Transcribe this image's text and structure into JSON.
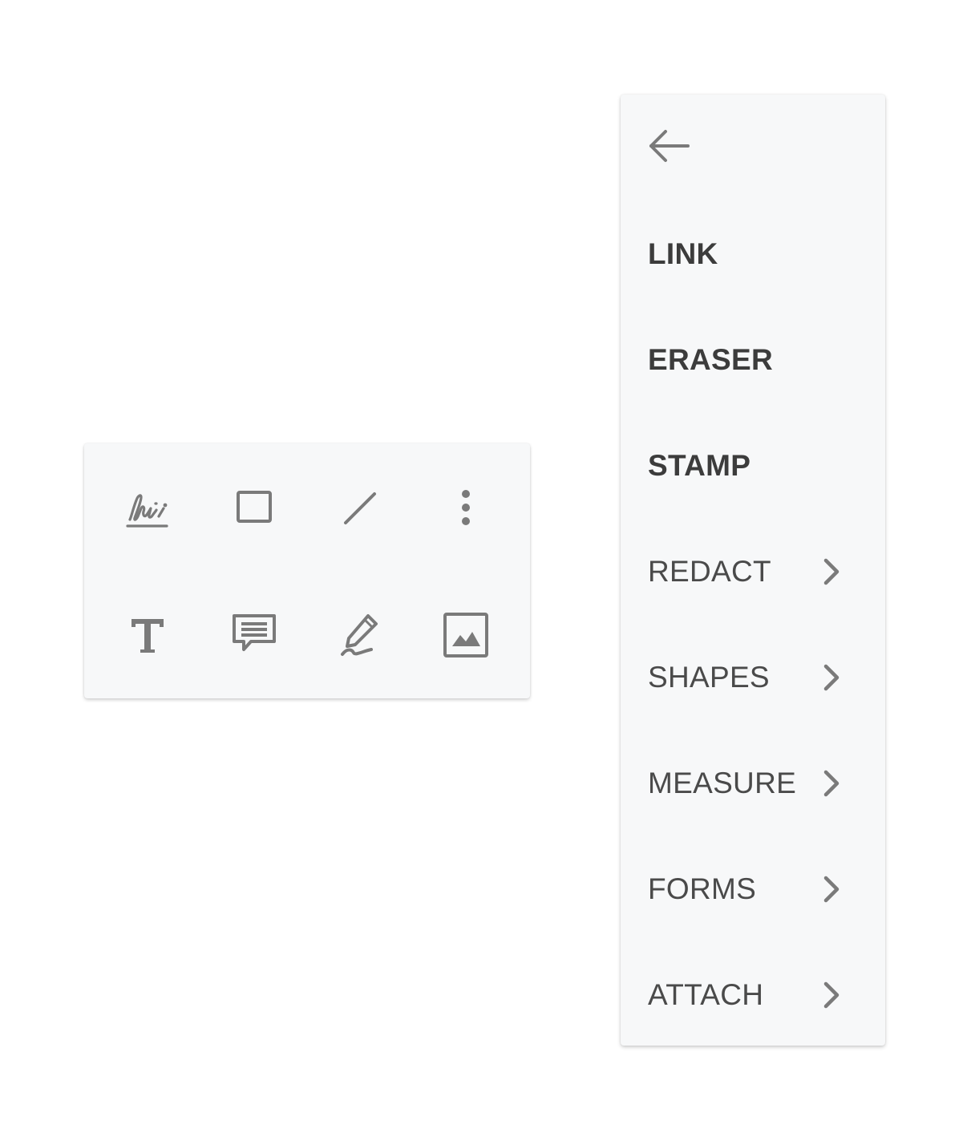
{
  "colors": {
    "panel_bg": "#f7f8f9",
    "icon_color": "#7a7a7a",
    "text_color": "#4a4a4a"
  },
  "toolbar": {
    "tools": [
      {
        "icon": "signature-icon"
      },
      {
        "icon": "rectangle-icon"
      },
      {
        "icon": "line-icon"
      },
      {
        "icon": "more-vertical-icon"
      },
      {
        "icon": "text-icon"
      },
      {
        "icon": "comment-icon"
      },
      {
        "icon": "pen-icon"
      },
      {
        "icon": "image-icon"
      }
    ]
  },
  "menu": {
    "back_icon": "arrow-left-icon",
    "items": [
      {
        "label": "LINK",
        "has_submenu": false
      },
      {
        "label": "ERASER",
        "has_submenu": false
      },
      {
        "label": "STAMP",
        "has_submenu": false
      },
      {
        "label": "REDACT",
        "has_submenu": true
      },
      {
        "label": "SHAPES",
        "has_submenu": true
      },
      {
        "label": "MEASURE",
        "has_submenu": true
      },
      {
        "label": "FORMS",
        "has_submenu": true
      },
      {
        "label": "ATTACH",
        "has_submenu": true
      }
    ]
  }
}
